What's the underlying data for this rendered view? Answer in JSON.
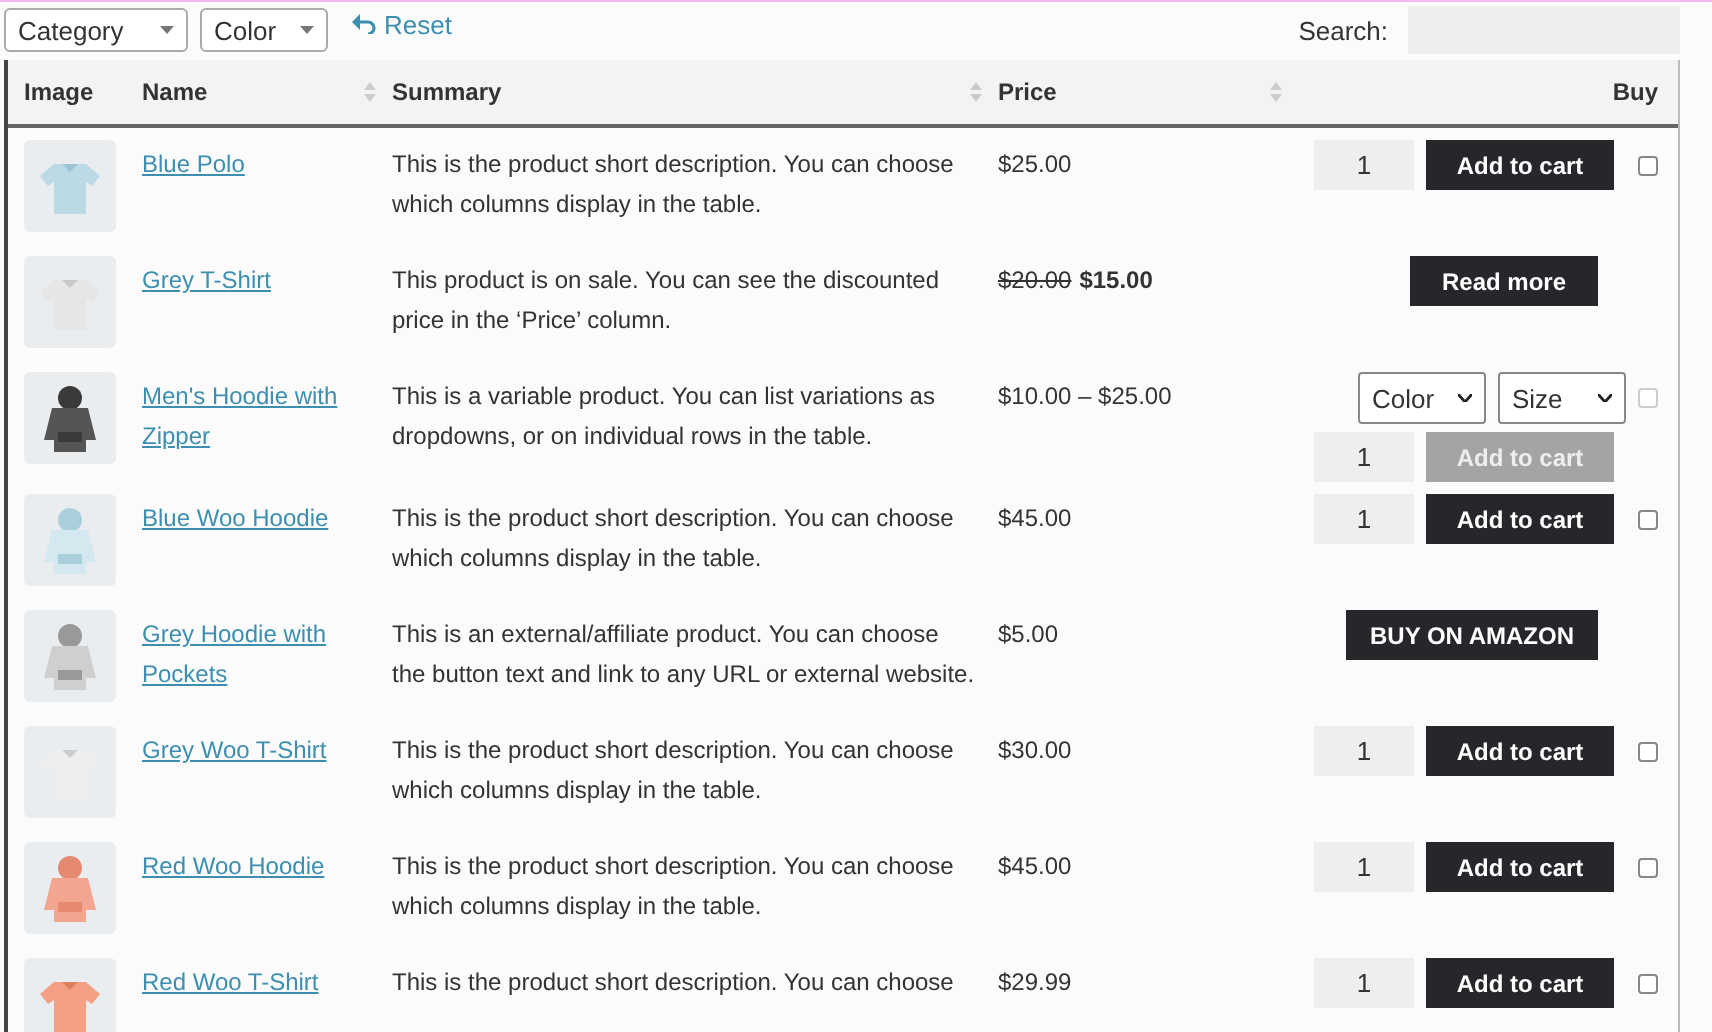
{
  "filters": [
    {
      "label": "Category"
    },
    {
      "label": "Color"
    }
  ],
  "reset": {
    "label": "Reset"
  },
  "search": {
    "label": "Search:"
  },
  "table": {
    "columns": [
      {
        "label": "Image",
        "sortable": false
      },
      {
        "label": "Name",
        "sortable": true
      },
      {
        "label": "Summary",
        "sortable": true
      },
      {
        "label": "Price",
        "sortable": true
      },
      {
        "label": "Buy",
        "sortable": false
      }
    ],
    "rows": [
      {
        "kind": "simple",
        "name": "Blue Polo",
        "summary": "This is the product short description. You can choose which columns display in the table.",
        "price": "$25.00",
        "quantity": "1",
        "button": "Add to cart",
        "checked": false
      },
      {
        "kind": "read_more",
        "name": "Grey T-Shirt",
        "summary": "This product is on sale. You can see the discounted price in the ‘Price’ column.",
        "old_price": "$20.00",
        "price": "$15.00",
        "button": "Read more"
      },
      {
        "kind": "variable",
        "name": "Men's Hoodie with Zipper",
        "summary": "This is a variable product. You can list variations as dropdowns, or on individual rows in the table.",
        "price": "$10.00 – $25.00",
        "options": [
          "Color",
          "Size"
        ],
        "quantity": "1",
        "button": "Add to cart",
        "disabled": true,
        "checked": false
      },
      {
        "kind": "simple",
        "name": "Blue Woo Hoodie",
        "summary": "This is the product short description. You can choose which columns display in the table.",
        "price": "$45.00",
        "quantity": "1",
        "button": "Add to cart",
        "checked": false
      },
      {
        "kind": "external",
        "name": "Grey Hoodie with Pockets",
        "summary": "This is an external/affiliate product. You can choose the button text and link to any URL or external website.",
        "price": "$5.00",
        "button": "BUY ON AMAZON"
      },
      {
        "kind": "simple",
        "name": "Grey Woo T-Shirt",
        "summary": "This is the product short description. You can choose which columns display in the table.",
        "price": "$30.00",
        "quantity": "1",
        "button": "Add to cart",
        "checked": false
      },
      {
        "kind": "simple",
        "name": "Red Woo Hoodie",
        "summary": "This is the product short description. You can choose which columns display in the table.",
        "price": "$45.00",
        "quantity": "1",
        "button": "Add to cart",
        "checked": false
      },
      {
        "kind": "simple",
        "name": "Red Woo T-Shirt",
        "summary": "This is the product short description. You can choose",
        "price": "$29.99",
        "quantity": "1",
        "button": "Add to cart",
        "checked": false
      }
    ]
  }
}
